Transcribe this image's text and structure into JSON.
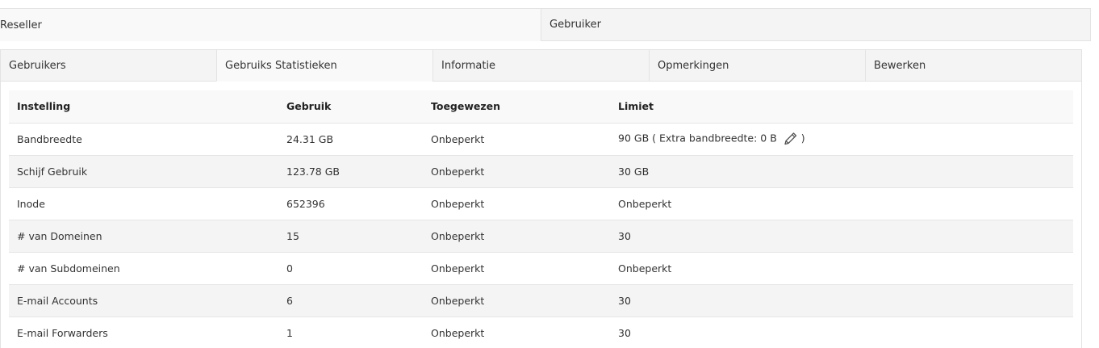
{
  "top_tabs": [
    {
      "label": "Reseller"
    },
    {
      "label": "Gebruiker"
    }
  ],
  "sub_tabs": [
    {
      "label": "Gebruikers"
    },
    {
      "label": "Gebruiks Statistieken"
    },
    {
      "label": "Informatie"
    },
    {
      "label": "Opmerkingen"
    },
    {
      "label": "Bewerken"
    }
  ],
  "table": {
    "headers": [
      "Instelling",
      "Gebruik",
      "Toegewezen",
      "Limiet"
    ],
    "rows": [
      {
        "setting": "Bandbreedte",
        "usage": "24.31 GB",
        "allocated": "Onbeperkt",
        "limit": "90 GB ( Extra bandbreedte: 0 B",
        "limit_suffix": ")"
      },
      {
        "setting": "Schijf Gebruik",
        "usage": "123.78 GB",
        "allocated": "Onbeperkt",
        "limit": "30 GB"
      },
      {
        "setting": "Inode",
        "usage": "652396",
        "allocated": "Onbeperkt",
        "limit": "Onbeperkt"
      },
      {
        "setting": "# van Domeinen",
        "usage": "15",
        "allocated": "Onbeperkt",
        "limit": "30"
      },
      {
        "setting": "# van Subdomeinen",
        "usage": "0",
        "allocated": "Onbeperkt",
        "limit": "Onbeperkt"
      },
      {
        "setting": "E-mail Accounts",
        "usage": "6",
        "allocated": "Onbeperkt",
        "limit": "30"
      },
      {
        "setting": "E-mail Forwarders",
        "usage": "1",
        "allocated": "Onbeperkt",
        "limit": "30"
      }
    ]
  },
  "icons": {
    "edit": "pencil-icon"
  },
  "colors": {
    "border": "#e3e3e3",
    "tab_inactive_bg": "#f4f4f4",
    "tab_active_bg": "#f9f9f9",
    "row_alt_bg": "#f4f4f4",
    "text": "#333333"
  }
}
